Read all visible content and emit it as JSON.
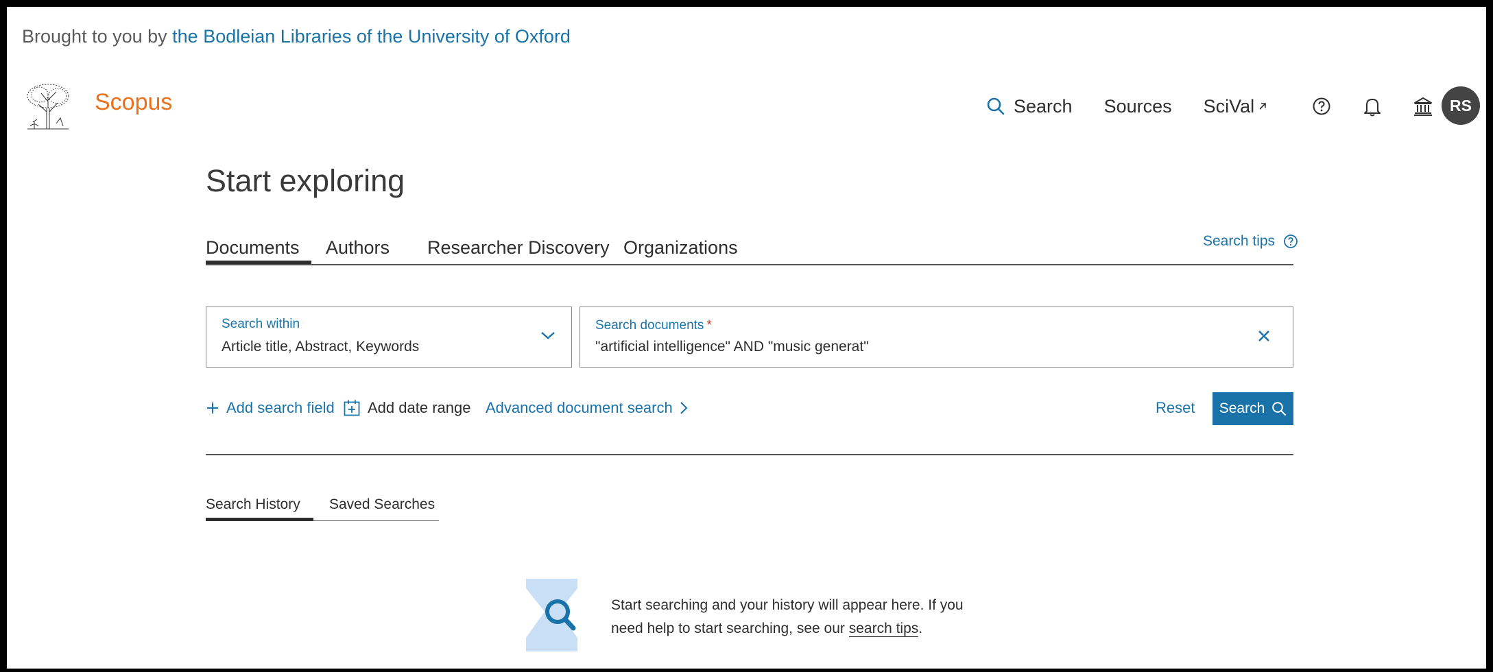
{
  "banner": {
    "prefix": "Brought to you by",
    "institution": "the Bodleian Libraries of the University of Oxford"
  },
  "header": {
    "brand": "Scopus",
    "nav": {
      "search": "Search",
      "sources": "Sources",
      "scival": "SciVal"
    },
    "avatar_initials": "RS"
  },
  "main": {
    "title": "Start exploring",
    "tabs": [
      "Documents",
      "Authors",
      "Researcher Discovery",
      "Organizations"
    ],
    "search_tips": "Search tips",
    "search_within": {
      "label": "Search within",
      "value": "Article title, Abstract, Keywords"
    },
    "search_documents": {
      "label": "Search documents",
      "required_mark": "*",
      "value": "\"artificial intelligence\" AND \"music generat\""
    },
    "actions": {
      "add_field": "Add search field",
      "add_date": "Add date range",
      "advanced": "Advanced document search",
      "reset": "Reset",
      "search": "Search"
    },
    "history_tabs": [
      "Search History",
      "Saved Searches"
    ],
    "empty": {
      "text_before": "Start searching and your history will appear here. If you need help to start searching, see our",
      "link": "search tips",
      "text_after": "."
    }
  },
  "colors": {
    "brand": "#e9711c",
    "accent": "#1a73a8",
    "text": "#2e2e2e"
  }
}
